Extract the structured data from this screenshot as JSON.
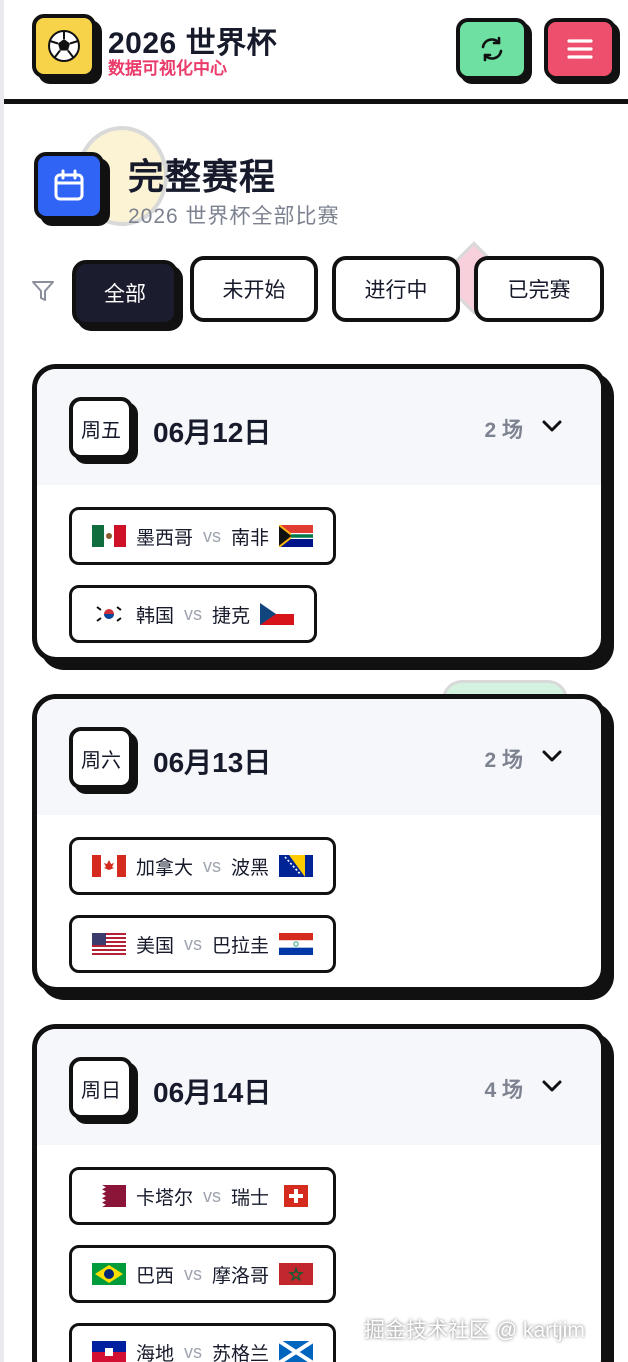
{
  "header": {
    "logo_icon": "soccer-ball-icon",
    "title": "2026 世界杯",
    "subtitle": "数据可视化中心",
    "refresh_icon": "refresh-icon",
    "menu_icon": "hamburger-menu-icon",
    "colors": {
      "logo_bg": "#f7d34a",
      "refresh_bg": "#6de0a2",
      "menu_bg": "#ee4f6d",
      "subtitle": "#ea3b6a"
    }
  },
  "section": {
    "icon": "calendar-icon",
    "title": "完整赛程",
    "subtitle": "2026 世界杯全部比赛"
  },
  "filter": {
    "icon": "filter-icon",
    "tabs": [
      {
        "label": "全部",
        "active": true
      },
      {
        "label": "未开始",
        "active": false
      },
      {
        "label": "进行中",
        "active": false
      },
      {
        "label": "已完赛",
        "active": false
      }
    ]
  },
  "days": [
    {
      "weekday": "周五",
      "date": "06月12日",
      "count": "2 场",
      "matches": [
        {
          "home": "墨西哥",
          "vs": "vs",
          "away": "南非"
        },
        {
          "home": "韩国",
          "vs": "vs",
          "away": "捷克"
        }
      ]
    },
    {
      "weekday": "周六",
      "date": "06月13日",
      "count": "2 场",
      "matches": [
        {
          "home": "加拿大",
          "vs": "vs",
          "away": "波黑"
        },
        {
          "home": "美国",
          "vs": "vs",
          "away": "巴拉圭"
        }
      ]
    },
    {
      "weekday": "周日",
      "date": "06月14日",
      "count": "4 场",
      "matches": [
        {
          "home": "卡塔尔",
          "vs": "vs",
          "away": "瑞士"
        },
        {
          "home": "巴西",
          "vs": "vs",
          "away": "摩洛哥"
        },
        {
          "home": "海地",
          "vs": "vs",
          "away": "苏格兰"
        }
      ]
    }
  ],
  "watermark": "掘金技术社区 @ kartjim"
}
